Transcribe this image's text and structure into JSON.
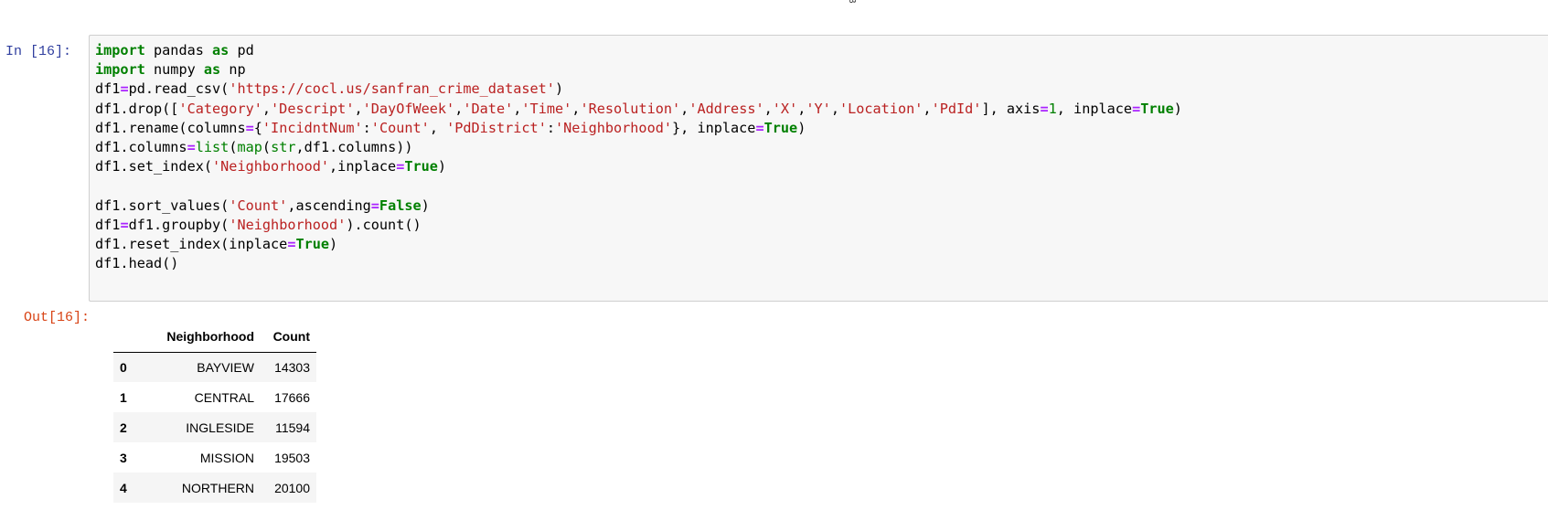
{
  "top_fragment": "B",
  "cell": {
    "input_prompt": "In [16]:",
    "output_prompt": "Out[16]:",
    "code_lines": [
      [
        {
          "t": "import",
          "c": "kw"
        },
        {
          "t": " pandas "
        },
        {
          "t": "as",
          "c": "kw"
        },
        {
          "t": " pd"
        }
      ],
      [
        {
          "t": "import",
          "c": "kw"
        },
        {
          "t": " numpy "
        },
        {
          "t": "as",
          "c": "kw"
        },
        {
          "t": " np"
        }
      ],
      [
        {
          "t": "df1"
        },
        {
          "t": "=",
          "c": "op"
        },
        {
          "t": "pd.read_csv("
        },
        {
          "t": "'https://cocl.us/sanfran_crime_dataset'",
          "c": "str"
        },
        {
          "t": ")"
        }
      ],
      [
        {
          "t": "df1.drop(["
        },
        {
          "t": "'Category'",
          "c": "str"
        },
        {
          "t": ","
        },
        {
          "t": "'Descript'",
          "c": "str"
        },
        {
          "t": ","
        },
        {
          "t": "'DayOfWeek'",
          "c": "str"
        },
        {
          "t": ","
        },
        {
          "t": "'Date'",
          "c": "str"
        },
        {
          "t": ","
        },
        {
          "t": "'Time'",
          "c": "str"
        },
        {
          "t": ","
        },
        {
          "t": "'Resolution'",
          "c": "str"
        },
        {
          "t": ","
        },
        {
          "t": "'Address'",
          "c": "str"
        },
        {
          "t": ","
        },
        {
          "t": "'X'",
          "c": "str"
        },
        {
          "t": ","
        },
        {
          "t": "'Y'",
          "c": "str"
        },
        {
          "t": ","
        },
        {
          "t": "'Location'",
          "c": "str"
        },
        {
          "t": ","
        },
        {
          "t": "'PdId'",
          "c": "str"
        },
        {
          "t": "], axis"
        },
        {
          "t": "=",
          "c": "op"
        },
        {
          "t": "1",
          "c": "num"
        },
        {
          "t": ", inplace"
        },
        {
          "t": "=",
          "c": "op"
        },
        {
          "t": "True",
          "c": "kw"
        },
        {
          "t": ")"
        }
      ],
      [
        {
          "t": "df1.rename(columns"
        },
        {
          "t": "=",
          "c": "op"
        },
        {
          "t": "{"
        },
        {
          "t": "'IncidntNum'",
          "c": "str"
        },
        {
          "t": ":"
        },
        {
          "t": "'Count'",
          "c": "str"
        },
        {
          "t": ", "
        },
        {
          "t": "'PdDistrict'",
          "c": "str"
        },
        {
          "t": ":"
        },
        {
          "t": "'Neighborhood'",
          "c": "str"
        },
        {
          "t": "}, inplace"
        },
        {
          "t": "=",
          "c": "op"
        },
        {
          "t": "True",
          "c": "kw"
        },
        {
          "t": ")"
        }
      ],
      [
        {
          "t": "df1.columns"
        },
        {
          "t": "=",
          "c": "op"
        },
        {
          "t": "list",
          "c": "bi"
        },
        {
          "t": "("
        },
        {
          "t": "map",
          "c": "bi"
        },
        {
          "t": "("
        },
        {
          "t": "str",
          "c": "bi"
        },
        {
          "t": ",df1.columns))"
        }
      ],
      [
        {
          "t": "df1.set_index("
        },
        {
          "t": "'Neighborhood'",
          "c": "str"
        },
        {
          "t": ",inplace"
        },
        {
          "t": "=",
          "c": "op"
        },
        {
          "t": "True",
          "c": "kw"
        },
        {
          "t": ")"
        }
      ],
      [],
      [
        {
          "t": "df1.sort_values("
        },
        {
          "t": "'Count'",
          "c": "str"
        },
        {
          "t": ",ascending"
        },
        {
          "t": "=",
          "c": "op"
        },
        {
          "t": "False",
          "c": "kw"
        },
        {
          "t": ")"
        }
      ],
      [
        {
          "t": "df1"
        },
        {
          "t": "=",
          "c": "op"
        },
        {
          "t": "df1.groupby("
        },
        {
          "t": "'Neighborhood'",
          "c": "str"
        },
        {
          "t": ").count()"
        }
      ],
      [
        {
          "t": "df1.reset_index(inplace"
        },
        {
          "t": "=",
          "c": "op"
        },
        {
          "t": "True",
          "c": "kw"
        },
        {
          "t": ")"
        }
      ],
      [
        {
          "t": "df1.head()"
        }
      ]
    ]
  },
  "output_table": {
    "columns": [
      "",
      "Neighborhood",
      "Count"
    ],
    "rows": [
      {
        "index": "0",
        "neighborhood": "BAYVIEW",
        "count": "14303"
      },
      {
        "index": "1",
        "neighborhood": "CENTRAL",
        "count": "17666"
      },
      {
        "index": "2",
        "neighborhood": "INGLESIDE",
        "count": "11594"
      },
      {
        "index": "3",
        "neighborhood": "MISSION",
        "count": "19503"
      },
      {
        "index": "4",
        "neighborhood": "NORTHERN",
        "count": "20100"
      }
    ]
  },
  "colors": {
    "input_prompt": "#303f9f",
    "output_prompt": "#d84315",
    "keyword": "#008000",
    "operator": "#aa22ff",
    "string": "#ba2121",
    "code_background": "#f7f7f7"
  }
}
